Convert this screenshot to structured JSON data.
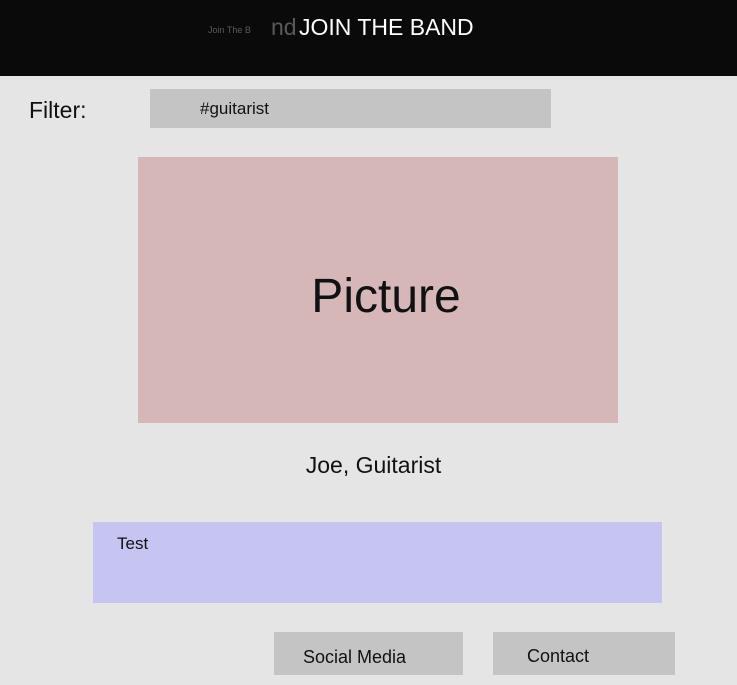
{
  "header": {
    "title": "JOIN THE BAND",
    "ghost_small": "Join The B",
    "ghost_big": "nd"
  },
  "filter": {
    "label": "Filter:",
    "value": "#guitarist"
  },
  "profile": {
    "picture_label": "Picture",
    "caption": "Joe, Guitarist"
  },
  "description": {
    "text": "Test"
  },
  "footer_buttons": {
    "social_label": "Social Media",
    "contact_label": "Contact"
  },
  "colors": {
    "header_bg": "#0a0a0a",
    "page_bg": "#e5e5e5",
    "input_bg": "#c4c4c4",
    "picture_bg": "#d6b7b8",
    "description_bg": "#c6c5f2"
  }
}
